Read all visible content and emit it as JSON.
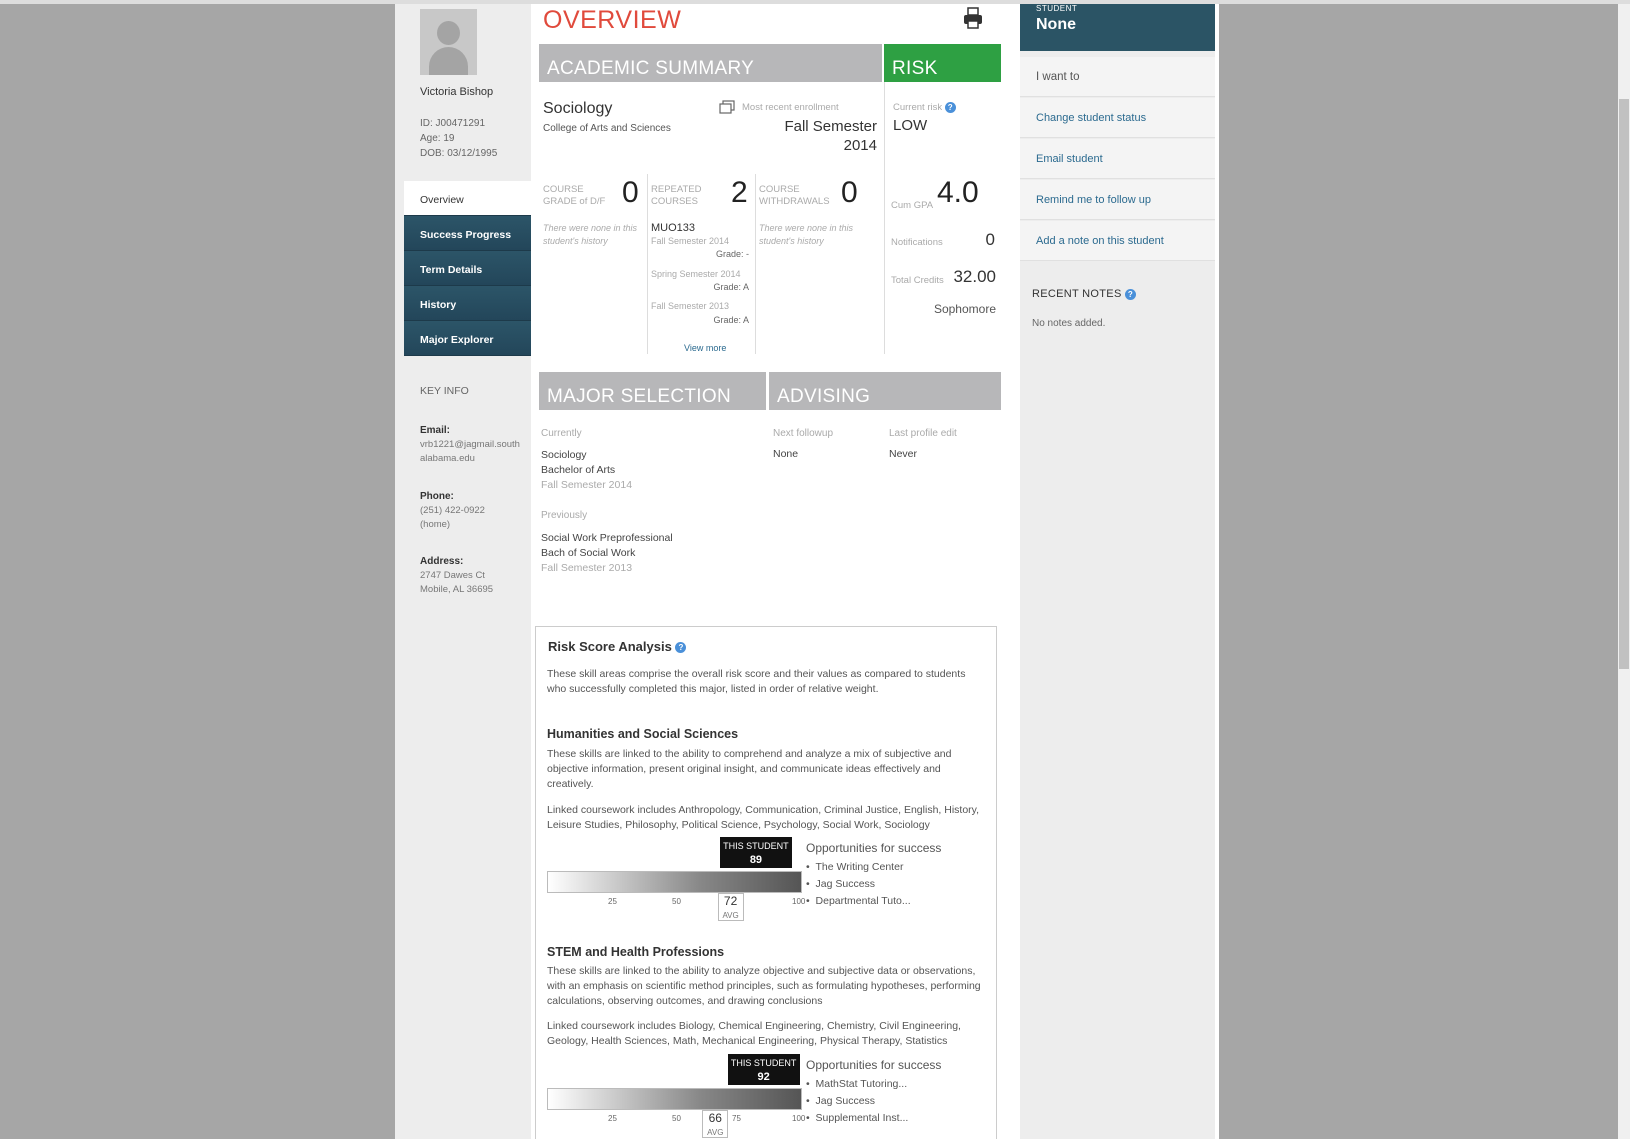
{
  "student": {
    "name": "Victoria Bishop",
    "id": "ID: J00471291",
    "age": "Age: 19",
    "dob": "DOB: 03/12/1995"
  },
  "nav": [
    {
      "label": "Overview",
      "active": true
    },
    {
      "label": "Success Progress"
    },
    {
      "label": "Term Details"
    },
    {
      "label": "History"
    },
    {
      "label": "Major Explorer"
    }
  ],
  "keyinfo": {
    "title": "KEY INFO",
    "email_label": "Email:",
    "email": "vrb1221@jagmail.southalabama.edu",
    "phone_label": "Phone:",
    "phone": "(251) 422-0922",
    "phone_type": "(home)",
    "address_label": "Address:",
    "address1": "2747 Dawes Ct",
    "address2": "Mobile, AL 36695"
  },
  "overview": {
    "title": "OVERVIEW",
    "academic_summary": "ACADEMIC SUMMARY",
    "risk": "RISK",
    "major": "Sociology",
    "college": "College of Arts and Sciences",
    "recent_label": "Most recent enrollment",
    "recent_value": "Fall Semester 2014",
    "current_risk_label": "Current risk",
    "current_risk_value": "LOW",
    "course_grade_label": "COURSE GRADE of D/F",
    "course_grade_value": "0",
    "course_grade_note": "There were none in this student's history",
    "repeated_label": "REPEATED COURSES",
    "repeated_value": "2",
    "repeated_course": "MUO133",
    "rep1_term": "Fall Semester 2014",
    "rep1_grade": "Grade: -",
    "rep2_term": "Spring Semester 2014",
    "rep2_grade": "Grade: A",
    "rep3_term": "Fall Semester 2013",
    "rep3_grade": "Grade: A",
    "view_more": "View more",
    "withdrawals_label": "COURSE WITHDRAWALS",
    "withdrawals_value": "0",
    "withdrawals_note": "There were none in this student's history",
    "gpa_label": "Cum GPA",
    "gpa_value": "4.0",
    "notif_label": "Notifications",
    "notif_value": "0",
    "credits_label": "Total Credits",
    "credits_value": "32.00",
    "class_level": "Sophomore",
    "major_selection": "MAJOR SELECTION",
    "advising": "ADVISING",
    "currently": "Currently",
    "cur_major": "Sociology",
    "cur_degree": "Bachelor of Arts",
    "cur_term": "Fall Semester 2014",
    "previously": "Previously",
    "prev_major": "Social Work Preprofessional",
    "prev_degree": "Bach of Social Work",
    "prev_term": "Fall Semester 2013",
    "next_followup_label": "Next followup",
    "next_followup_value": "None",
    "last_edit_label": "Last profile edit",
    "last_edit_value": "Never"
  },
  "risk_analysis": {
    "title": "Risk Score Analysis",
    "intro": "These skill areas comprise the overall risk score and their values as compared to students who successfully completed this major, listed in order of relative weight.",
    "this_student": "THIS STUDENT",
    "avg_label": "AVG",
    "opp_title": "Opportunities for success",
    "sections": [
      {
        "title": "Humanities and Social Sciences",
        "desc": "These skills are linked to the ability to comprehend and analyze a mix of subjective and objective information, present original insight, and communicate ideas effectively and creatively.",
        "linked": "Linked coursework includes Anthropology, Communication, Criminal Justice, English, History, Leisure Studies, Philosophy, Political Science, Psychology, Social Work, Sociology",
        "student_score": 89,
        "avg_score": 72,
        "ticks": [
          "25",
          "50",
          "100"
        ],
        "opps": [
          "The Writing Center",
          "Jag Success",
          "Departmental Tuto..."
        ]
      },
      {
        "title": "STEM and Health Professions",
        "desc": "These skills are linked to the ability to analyze objective and subjective data or observations, with an emphasis on scientific method principles, such as formulating hypotheses, performing calculations, observing outcomes, and drawing conclusions",
        "linked": "Linked coursework includes Biology, Chemical Engineering, Chemistry, Civil Engineering, Geology, Health Sciences, Math, Mechanical Engineering, Physical Therapy, Statistics",
        "student_score": 92,
        "avg_score": 66,
        "ticks": [
          "25",
          "50",
          "75",
          "100"
        ],
        "opps": [
          "MathStat Tutoring...",
          "Jag Success",
          "Supplemental Inst..."
        ]
      }
    ]
  },
  "right": {
    "student_label": "STUDENT",
    "student_value": "None",
    "want_to": "I want to",
    "actions": [
      "Change student status",
      "Email student",
      "Remind me to follow up",
      "Add a note on this student"
    ],
    "recent_notes": "RECENT NOTES",
    "no_notes": "No notes added."
  },
  "colors": {
    "accent": "#e04a3c",
    "risk_green": "#2ea043",
    "nav": "#2b5465",
    "bar_gray": "#b7b7b9"
  }
}
